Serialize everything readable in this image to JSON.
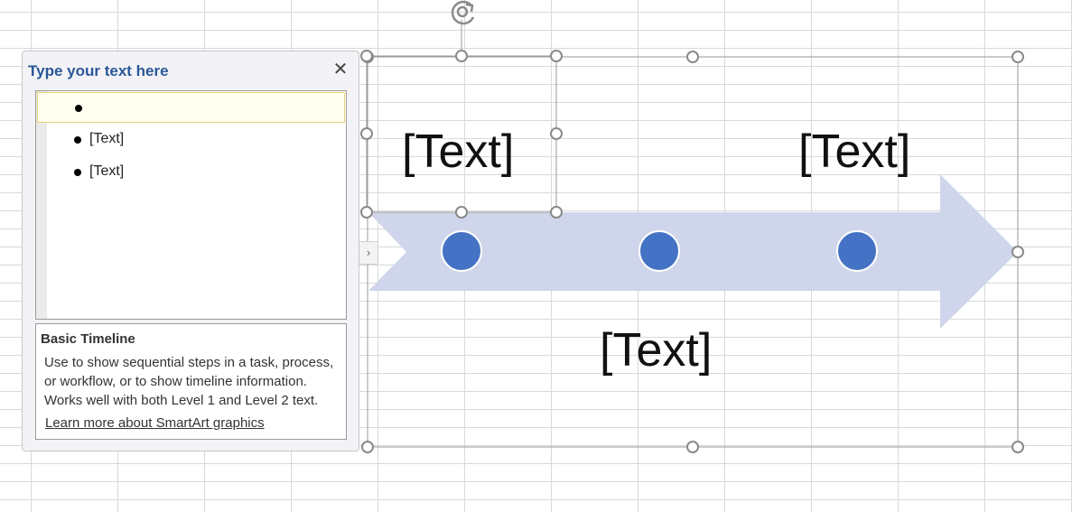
{
  "text_pane": {
    "title": "Type your text here",
    "close_icon": "close-icon",
    "bullets": [
      {
        "text": ""
      },
      {
        "text": "[Text]"
      },
      {
        "text": "[Text]"
      }
    ],
    "info": {
      "title": "Basic Timeline",
      "description": "Use to show sequential steps in a task, process, or workflow, or to show timeline information. Works well with both Level 1 and Level 2 text.",
      "link": "Learn more about SmartArt graphics"
    },
    "expand_icon": "chevron-right-icon"
  },
  "smartart": {
    "labels": [
      "[Text]",
      "[Text]",
      "[Text]"
    ],
    "arrow_color": "#cfd5ea",
    "node_color": "#4472c4",
    "handle_color": "#8a8a8a",
    "rotate_icon": "rotate-icon"
  }
}
